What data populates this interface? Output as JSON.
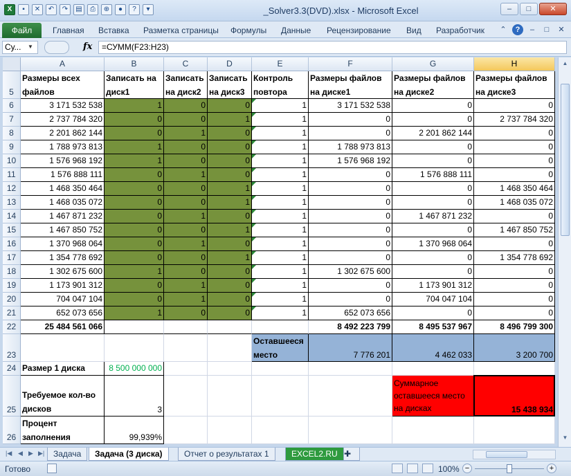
{
  "window": {
    "title": "_Solver3.3(DVD).xlsx - Microsoft Excel",
    "minimize": "–",
    "restore": "□",
    "close": "✕"
  },
  "ribbon": {
    "file": "Файл",
    "tabs": [
      "Главная",
      "Вставка",
      "Разметка страницы",
      "Формулы",
      "Данные",
      "Рецензирование",
      "Вид",
      "Разработчик"
    ]
  },
  "formula_bar": {
    "name_box": "Су...",
    "fx": "fx",
    "formula": "=СУММ(F23:H23)"
  },
  "columns": [
    "A",
    "B",
    "C",
    "D",
    "E",
    "F",
    "G",
    "H"
  ],
  "header_row": {
    "row": "5",
    "A": "Размеры всех файлов",
    "B": "Записать на диск1",
    "C": "Записать на диск2",
    "D": "Записать на диск3",
    "E": "Контроль повтора",
    "F": "Размеры файлов на диске1",
    "G": "Размеры файлов на диске2",
    "H": "Размеры файлов на диске3"
  },
  "rows": [
    {
      "row": "6",
      "a": "3 171 532 538",
      "b": "1",
      "c": "0",
      "d": "0",
      "e": "1",
      "f": "3 171 532 538",
      "g": "0",
      "h": "0"
    },
    {
      "row": "7",
      "a": "2 737 784 320",
      "b": "0",
      "c": "0",
      "d": "1",
      "e": "1",
      "f": "0",
      "g": "0",
      "h": "2 737 784 320"
    },
    {
      "row": "8",
      "a": "2 201 862 144",
      "b": "0",
      "c": "1",
      "d": "0",
      "e": "1",
      "f": "0",
      "g": "2 201 862 144",
      "h": "0"
    },
    {
      "row": "9",
      "a": "1 788 973 813",
      "b": "1",
      "c": "0",
      "d": "0",
      "e": "1",
      "f": "1 788 973 813",
      "g": "0",
      "h": "0"
    },
    {
      "row": "10",
      "a": "1 576 968 192",
      "b": "1",
      "c": "0",
      "d": "0",
      "e": "1",
      "f": "1 576 968 192",
      "g": "0",
      "h": "0"
    },
    {
      "row": "11",
      "a": "1 576 888 111",
      "b": "0",
      "c": "1",
      "d": "0",
      "e": "1",
      "f": "0",
      "g": "1 576 888 111",
      "h": "0"
    },
    {
      "row": "12",
      "a": "1 468 350 464",
      "b": "0",
      "c": "0",
      "d": "1",
      "e": "1",
      "f": "0",
      "g": "0",
      "h": "1 468 350 464"
    },
    {
      "row": "13",
      "a": "1 468 035 072",
      "b": "0",
      "c": "0",
      "d": "1",
      "e": "1",
      "f": "0",
      "g": "0",
      "h": "1 468 035 072"
    },
    {
      "row": "14",
      "a": "1 467 871 232",
      "b": "0",
      "c": "1",
      "d": "0",
      "e": "1",
      "f": "0",
      "g": "1 467 871 232",
      "h": "0"
    },
    {
      "row": "15",
      "a": "1 467 850 752",
      "b": "0",
      "c": "0",
      "d": "1",
      "e": "1",
      "f": "0",
      "g": "0",
      "h": "1 467 850 752"
    },
    {
      "row": "16",
      "a": "1 370 968 064",
      "b": "0",
      "c": "1",
      "d": "0",
      "e": "1",
      "f": "0",
      "g": "1 370 968 064",
      "h": "0"
    },
    {
      "row": "17",
      "a": "1 354 778 692",
      "b": "0",
      "c": "0",
      "d": "1",
      "e": "1",
      "f": "0",
      "g": "0",
      "h": "1 354 778 692"
    },
    {
      "row": "18",
      "a": "1 302 675 600",
      "b": "1",
      "c": "0",
      "d": "0",
      "e": "1",
      "f": "1 302 675 600",
      "g": "0",
      "h": "0"
    },
    {
      "row": "19",
      "a": "1 173 901 312",
      "b": "0",
      "c": "1",
      "d": "0",
      "e": "1",
      "f": "0",
      "g": "1 173 901 312",
      "h": "0"
    },
    {
      "row": "20",
      "a": "704 047 104",
      "b": "0",
      "c": "1",
      "d": "0",
      "e": "1",
      "f": "0",
      "g": "704 047 104",
      "h": "0"
    },
    {
      "row": "21",
      "a": "652 073 656",
      "b": "1",
      "c": "0",
      "d": "0",
      "e": "1",
      "f": "652 073 656",
      "g": "0",
      "h": "0"
    }
  ],
  "totals": {
    "row": "22",
    "a": "25 484 561 066",
    "f": "8 492 223 799",
    "g": "8 495 537 967",
    "h": "8 496 799 300"
  },
  "remaining": {
    "row": "23",
    "label": "Оставшееся место",
    "f": "7 776 201",
    "g": "4 462 033",
    "h": "3 200 700"
  },
  "disk_size": {
    "row": "24",
    "label": "Размер 1 диска",
    "value": "8 500 000 000"
  },
  "disks_needed": {
    "row": "25",
    "label": "Требуемое кол-во дисков",
    "value": "3",
    "summary_label": "Суммарное оставшееся место на дисках",
    "summary_value": "15 438 934"
  },
  "fill_percent": {
    "row": "26",
    "label": "Процент заполнения",
    "value": "99,939%"
  },
  "sheets": {
    "tabs": [
      "Задача",
      "Задача (3 диска)",
      "Отчет о результатах 1",
      "EXCEL2.RU"
    ]
  },
  "status": {
    "ready": "Готово",
    "zoom": "100%",
    "zoom_minus": "−",
    "zoom_plus": "+"
  },
  "colors": {
    "green_cell": "#76923c",
    "blue_cell": "#95b3d7",
    "red_cell": "#ff0000",
    "file_tab": "#2e7d3a"
  }
}
